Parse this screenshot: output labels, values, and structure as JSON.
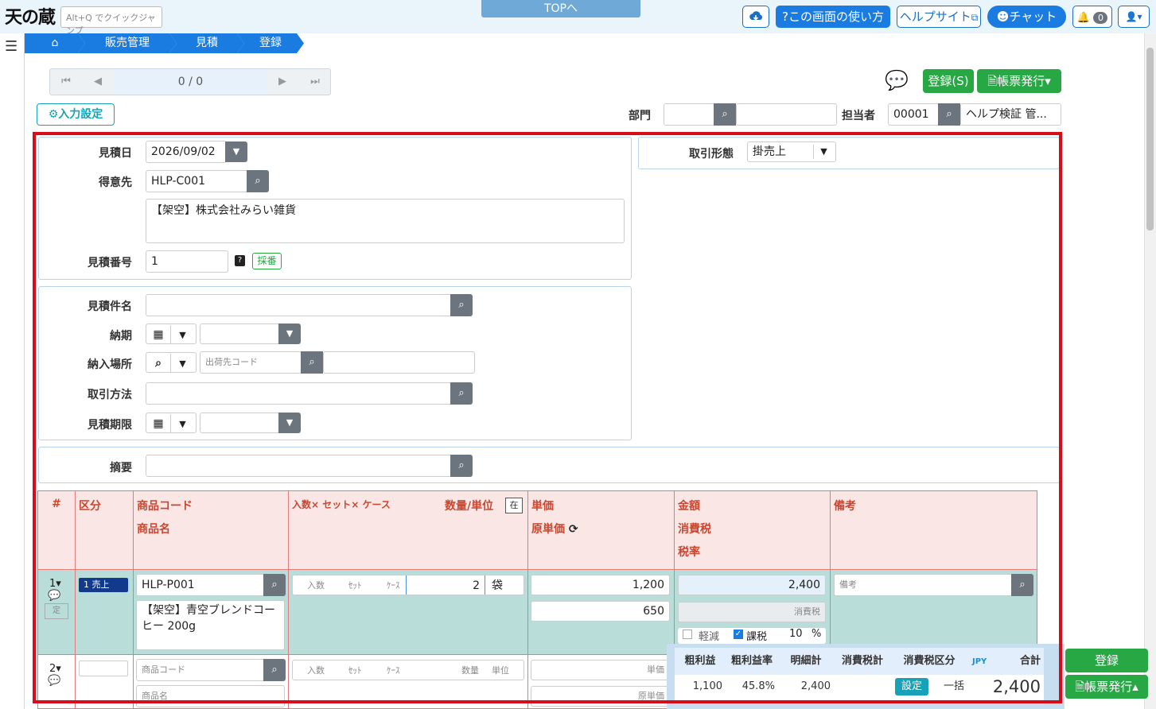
{
  "topbar": {
    "logo_text": "天の蔵",
    "quick_jump": "Alt+Q でクイックジャンプ",
    "top_link": "TOPへ",
    "usage_label": "この画面の使い方",
    "help_site_label": "ヘルプサイト",
    "chat_label": "チャット",
    "notifications_count": "0"
  },
  "breadcrumb": {
    "items": [
      "販売管理",
      "見積",
      "登録"
    ]
  },
  "pager": {
    "position": "0 / 0"
  },
  "actions": {
    "register_label": "登録(S)",
    "issue_label": "帳票発行"
  },
  "input_settings_label": "入力設定",
  "header_fields": {
    "department_label": "部門",
    "department_code": "",
    "department_name": "",
    "staff_label": "担当者",
    "staff_code": "00001",
    "staff_name": "ヘルプ検証 管..."
  },
  "form": {
    "estimate_date_label": "見積日",
    "estimate_date": "2026/09/02",
    "customer_label": "得意先",
    "customer_code": "HLP-C001",
    "customer_name": "【架空】株式会社みらい雑貨",
    "estimate_no_label": "見積番号",
    "estimate_no": "1",
    "numbering_label": "採番",
    "trade_type_label": "取引形態",
    "trade_type": "掛売上",
    "subject_label": "見積件名",
    "delivery_date_label": "納期",
    "delivery_place_label": "納入場所",
    "ship_code_placeholder": "出荷先コード",
    "trade_method_label": "取引方法",
    "validity_label": "見積期限",
    "summary_label": "摘要"
  },
  "table": {
    "headers": {
      "no": "#",
      "kind": "区分",
      "product_code": "商品コード",
      "product_name": "商品名",
      "qty_header": "入数× セット× ケース",
      "qty_unit": "数量/単位",
      "stock_btn": "在",
      "unit_price": "単価",
      "cost_price": "原単価",
      "amount": "金額",
      "tax": "消費税",
      "tax_rate": "税率",
      "remarks": "備考"
    },
    "row1": {
      "no": "1▾",
      "kind": "1 売上",
      "fixed_label": "定",
      "product_code": "HLP-P001",
      "product_name": "【架空】青空ブレンドコーヒー 200g",
      "per_box": "入数",
      "set": "ｾｯﾄ",
      "case": "ｹｰｽ",
      "qty": "2",
      "unit": "袋",
      "unit_price": "1,200",
      "cost_price": "650",
      "amount": "2,400",
      "tax_placeholder": "消費税",
      "reduced_label": "軽減",
      "taxable_label": "課税",
      "tax_rate": "10",
      "percent": "%",
      "remarks_placeholder": "備考"
    },
    "row2": {
      "no": "2▾",
      "product_code_placeholder": "商品コード",
      "product_name_placeholder": "商品名",
      "per_box": "入数",
      "set": "ｾｯﾄ",
      "case": "ｹｰｽ",
      "qty_placeholder": "数量",
      "unit_placeholder": "単位",
      "unit_price_placeholder": "単価",
      "cost_price_placeholder": "原単価"
    }
  },
  "summary": {
    "gross_profit_label": "粗利益",
    "gross_margin_label": "粗利益率",
    "detail_total_label": "明細計",
    "tax_total_label": "消費税計",
    "tax_category_label": "消費税区分",
    "currency": "JPY",
    "total_label": "合計",
    "gross_profit": "1,100",
    "gross_margin": "45.8%",
    "detail_total": "2,400",
    "tax_total": "",
    "setting_label": "設定",
    "tax_category": "一括",
    "total": "2,400"
  },
  "bottom": {
    "register_label": "登録",
    "issue_label": "帳票発行"
  }
}
